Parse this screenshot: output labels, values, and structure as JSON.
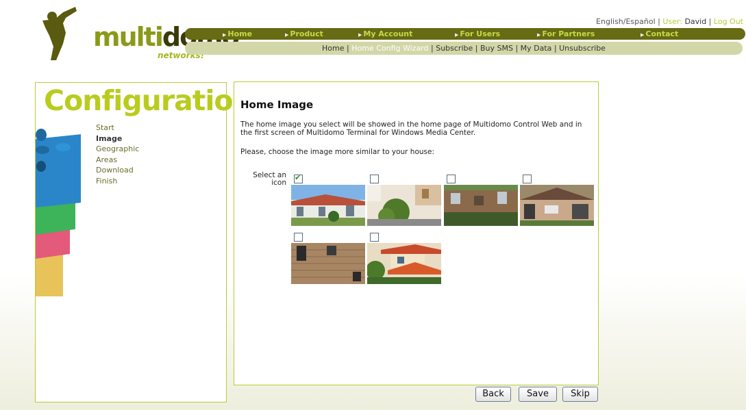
{
  "logo": {
    "text_multi": "multi",
    "text_domo": "domo",
    "sub": "networks!"
  },
  "top_links": {
    "lang": "English/Español",
    "sep1": " | ",
    "user_label": "User: ",
    "user_name": "David",
    "sep2": " | ",
    "logout": "Log Out"
  },
  "nav_main": [
    {
      "label": "Home"
    },
    {
      "label": "Product"
    },
    {
      "label": "My Account"
    },
    {
      "label": "For Users"
    },
    {
      "label": "For Partners"
    },
    {
      "label": "Contact"
    }
  ],
  "nav_sub": [
    {
      "label": "Home"
    },
    {
      "label": "Home Config Wizard"
    },
    {
      "label": "Subscribe"
    },
    {
      "label": "Buy SMS"
    },
    {
      "label": "My Data"
    },
    {
      "label": "Unsubscribe"
    }
  ],
  "nav_sub_active": "Home Config Wizard",
  "sidebar": {
    "title": "Configuration",
    "steps": [
      "Start",
      "Image",
      "Geographic",
      "Areas",
      "Download",
      "Finish"
    ],
    "current_step": "Image"
  },
  "main": {
    "title": "Home Image",
    "description": "The home image you select will be showed in the home page of Multidomo Control Web and in the first screen of Multidomo Terminal for Windows Media Center.",
    "prompt": "Please, choose the image more similar to your house:",
    "select_label": "Select an icon",
    "images": [
      {
        "name": "house-image-1",
        "checked": true
      },
      {
        "name": "house-image-2",
        "checked": false
      },
      {
        "name": "house-image-3",
        "checked": false
      },
      {
        "name": "house-image-4",
        "checked": false
      },
      {
        "name": "house-image-5",
        "checked": false
      },
      {
        "name": "house-image-6",
        "checked": false
      }
    ]
  },
  "buttons": {
    "back": "Back",
    "save": "Save",
    "skip": "Skip"
  },
  "colors": {
    "accent": "#b9cc33",
    "nav_dark": "#666b14",
    "nav_light": "#d3d6a8"
  }
}
